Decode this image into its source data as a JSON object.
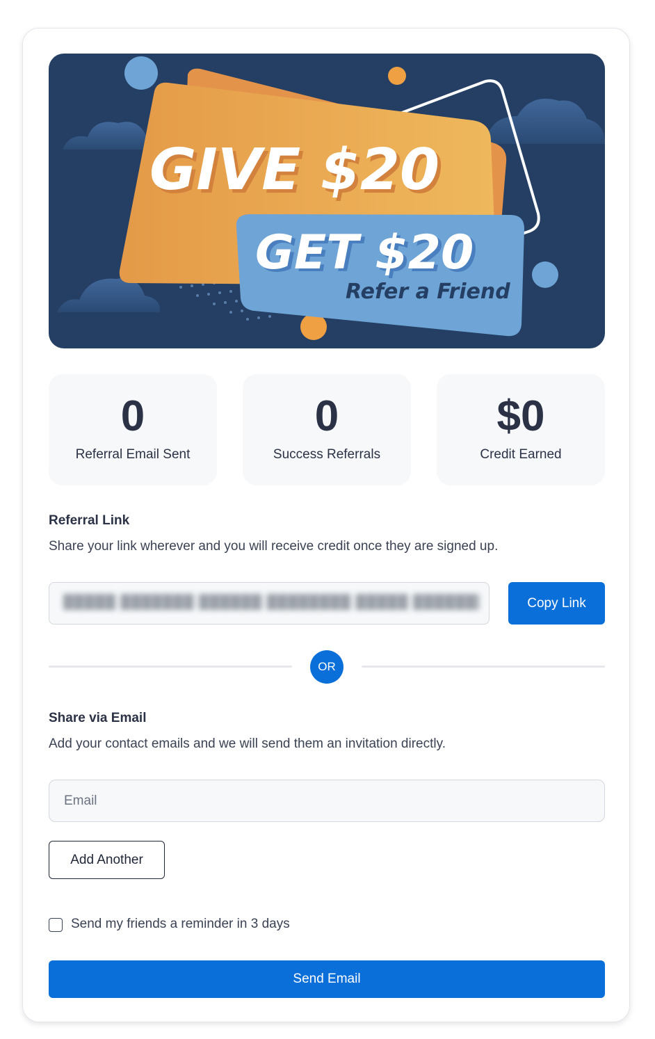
{
  "banner": {
    "headline_give": "GIVE $20",
    "headline_get": "GET $20",
    "tagline": "Refer a Friend"
  },
  "stats": [
    {
      "value": "0",
      "label": "Referral Email Sent"
    },
    {
      "value": "0",
      "label": "Success Referrals"
    },
    {
      "value": "$0",
      "label": "Credit Earned"
    }
  ],
  "referral_link": {
    "title": "Referral Link",
    "description": "Share your link wherever and you will receive credit once they are signed up.",
    "copy_label": "Copy Link"
  },
  "divider": {
    "label": "OR"
  },
  "share_email": {
    "title": "Share via Email",
    "description": "Add your contact emails and we will send them an invitation directly.",
    "email_placeholder": "Email",
    "add_another_label": "Add Another",
    "reminder_label": "Send my friends a reminder in 3 days",
    "reminder_checked": false,
    "send_label": "Send Email"
  },
  "colors": {
    "primary": "#0a6fd8",
    "banner_bg": "#243f63",
    "card_orange": "#eda64d",
    "tag_blue": "#6fa4d6",
    "stat_bg": "#f6f8fa"
  }
}
